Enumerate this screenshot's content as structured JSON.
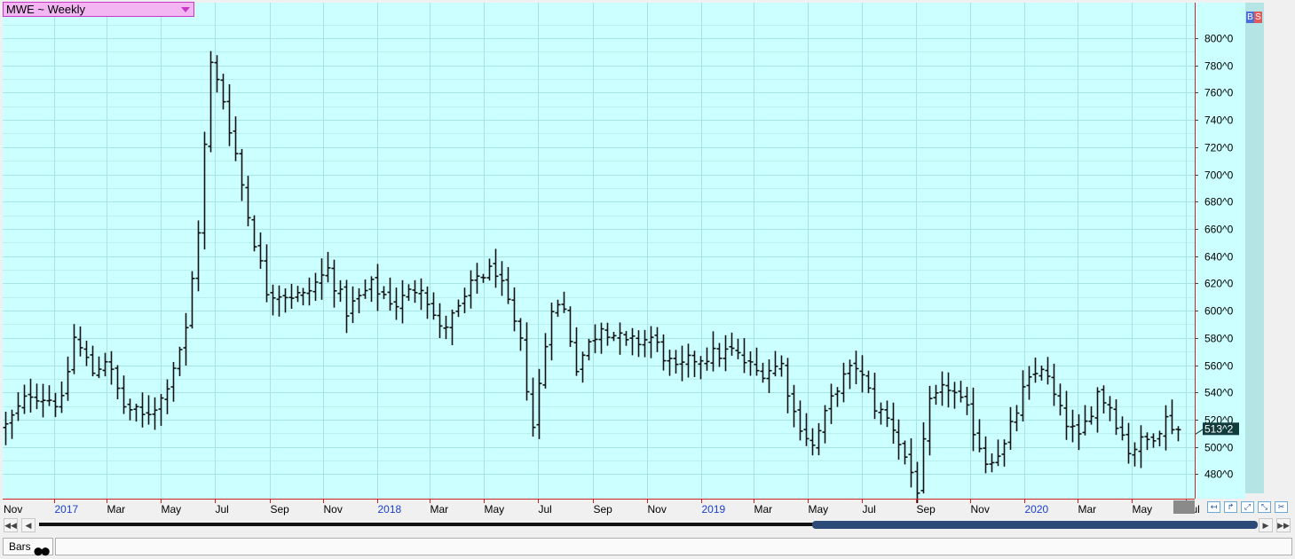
{
  "toolbar": {
    "symbol_label": "MWE ~ Weekly"
  },
  "badges": {
    "buy": "B",
    "sell": "S"
  },
  "footer": {
    "tab_label": "Bars"
  },
  "colors": {
    "plot_bg": "#ccffff",
    "grid": "#a8e4e4",
    "bar": "#111111",
    "border": "#cc2222",
    "date_blue": "#1a3fd0",
    "last_box": "#123c3c"
  },
  "chart_data": {
    "type": "ohlc",
    "title": "MWE ~ Weekly",
    "ylim": [
      462,
      826
    ],
    "y_ticks": [
      480,
      500,
      520,
      540,
      560,
      580,
      600,
      620,
      640,
      660,
      680,
      700,
      720,
      740,
      760,
      780,
      800
    ],
    "y_tick_labels": [
      "480^0",
      "500^0",
      "520^0",
      "540^0",
      "560^0",
      "580^0",
      "600^0",
      "620^0",
      "640^0",
      "660^0",
      "680^0",
      "700^0",
      "720^0",
      "740^0",
      "760^0",
      "780^0",
      "800^0"
    ],
    "x_range": [
      "2016-11-07",
      "2020-07-06"
    ],
    "x_labels": [
      {
        "date": "2016-11-01",
        "label": "Nov",
        "year": false
      },
      {
        "date": "2017-01-01",
        "label": "2017",
        "year": true
      },
      {
        "date": "2017-03-01",
        "label": "Mar",
        "year": false
      },
      {
        "date": "2017-05-01",
        "label": "May",
        "year": false
      },
      {
        "date": "2017-07-01",
        "label": "Jul",
        "year": false
      },
      {
        "date": "2017-09-01",
        "label": "Sep",
        "year": false
      },
      {
        "date": "2017-11-01",
        "label": "Nov",
        "year": false
      },
      {
        "date": "2018-01-01",
        "label": "2018",
        "year": true
      },
      {
        "date": "2018-03-01",
        "label": "Mar",
        "year": false
      },
      {
        "date": "2018-05-01",
        "label": "May",
        "year": false
      },
      {
        "date": "2018-07-01",
        "label": "Jul",
        "year": false
      },
      {
        "date": "2018-09-01",
        "label": "Sep",
        "year": false
      },
      {
        "date": "2018-11-01",
        "label": "Nov",
        "year": false
      },
      {
        "date": "2019-01-01",
        "label": "2019",
        "year": true
      },
      {
        "date": "2019-03-01",
        "label": "Mar",
        "year": false
      },
      {
        "date": "2019-05-01",
        "label": "May",
        "year": false
      },
      {
        "date": "2019-07-01",
        "label": "Jul",
        "year": false
      },
      {
        "date": "2019-09-01",
        "label": "Sep",
        "year": false
      },
      {
        "date": "2019-11-01",
        "label": "Nov",
        "year": false
      },
      {
        "date": "2020-01-01",
        "label": "2020",
        "year": true
      },
      {
        "date": "2020-03-01",
        "label": "Mar",
        "year": false
      },
      {
        "date": "2020-05-01",
        "label": "May",
        "year": false
      },
      {
        "date": "2020-07-01",
        "label": "Jul",
        "year": false
      }
    ],
    "anchors": [
      [
        "2016-11-07",
        515
      ],
      [
        "2016-12-05",
        540
      ],
      [
        "2017-01-09",
        532
      ],
      [
        "2017-01-23",
        580
      ],
      [
        "2017-02-13",
        555
      ],
      [
        "2017-02-27",
        565
      ],
      [
        "2017-03-20",
        530
      ],
      [
        "2017-04-10",
        522
      ],
      [
        "2017-05-01",
        535
      ],
      [
        "2017-05-29",
        585
      ],
      [
        "2017-06-12",
        660
      ],
      [
        "2017-06-26",
        780
      ],
      [
        "2017-07-10",
        755
      ],
      [
        "2017-07-24",
        715
      ],
      [
        "2017-08-07",
        670
      ],
      [
        "2017-08-28",
        615
      ],
      [
        "2017-10-09",
        610
      ],
      [
        "2017-11-06",
        630
      ],
      [
        "2017-11-27",
        600
      ],
      [
        "2017-12-25",
        618
      ],
      [
        "2018-01-22",
        605
      ],
      [
        "2018-02-19",
        620
      ],
      [
        "2018-03-12",
        585
      ],
      [
        "2018-04-02",
        600
      ],
      [
        "2018-04-23",
        625
      ],
      [
        "2018-05-14",
        630
      ],
      [
        "2018-06-11",
        575
      ],
      [
        "2018-06-25",
        515
      ],
      [
        "2018-07-16",
        605
      ],
      [
        "2018-07-30",
        600
      ],
      [
        "2018-08-13",
        560
      ],
      [
        "2018-09-10",
        590
      ],
      [
        "2018-10-08",
        575
      ],
      [
        "2018-11-05",
        580
      ],
      [
        "2018-12-03",
        555
      ],
      [
        "2018-12-24",
        565
      ],
      [
        "2019-02-04",
        570
      ],
      [
        "2019-03-04",
        555
      ],
      [
        "2019-04-01",
        560
      ],
      [
        "2019-04-15",
        525
      ],
      [
        "2019-05-06",
        500
      ],
      [
        "2019-06-03",
        545
      ],
      [
        "2019-06-24",
        560
      ],
      [
        "2019-07-15",
        530
      ],
      [
        "2019-08-05",
        515
      ],
      [
        "2019-09-02",
        470
      ],
      [
        "2019-09-16",
        530
      ],
      [
        "2019-10-07",
        545
      ],
      [
        "2019-10-28",
        525
      ],
      [
        "2019-11-18",
        490
      ],
      [
        "2019-12-09",
        500
      ],
      [
        "2019-12-30",
        540
      ],
      [
        "2020-01-20",
        560
      ],
      [
        "2020-02-10",
        525
      ],
      [
        "2020-03-02",
        505
      ],
      [
        "2020-03-23",
        540
      ],
      [
        "2020-04-06",
        530
      ],
      [
        "2020-04-27",
        498
      ],
      [
        "2020-05-18",
        505
      ],
      [
        "2020-06-08",
        520
      ],
      [
        "2020-06-22",
        513
      ]
    ],
    "last_value": 513.25,
    "last_label": "513^2"
  }
}
